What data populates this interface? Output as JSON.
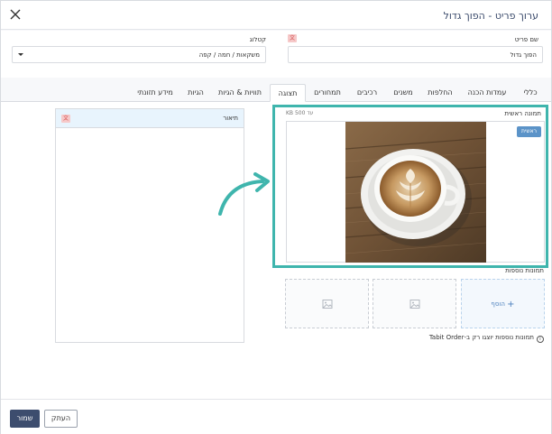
{
  "header": {
    "title": "ערוך פריט  -  הפוך גדול",
    "close_icon": "close-icon"
  },
  "form": {
    "item_name_label": "שם פריט",
    "item_name_value": "הפוך גדול",
    "catalog_label": "קטלוג",
    "catalog_value": "משקאות / חמה / קפה",
    "flag_icon": "translate-flag-icon"
  },
  "tabs": [
    {
      "label": "כללי"
    },
    {
      "label": "עמדות הכנה"
    },
    {
      "label": "החלפות"
    },
    {
      "label": "משנים"
    },
    {
      "label": "רכיבים"
    },
    {
      "label": "תמחורים"
    },
    {
      "label": "תצוגה"
    },
    {
      "label": "תוויות & הגיות"
    },
    {
      "label": "הגיות"
    },
    {
      "label": "מידע תזונתי"
    }
  ],
  "active_tab": "תצוגה",
  "display": {
    "main_image_label": "תמונה ראשית",
    "size_limit": "עד 500 KB",
    "main_badge": "ראשית",
    "more_images_label": "תמונות נוספות",
    "add_label": "הוסף",
    "info_text": "תמונות נוספות יוצגו רק ב-Tabit Order",
    "info_icon": "info-icon",
    "image_placeholder_icon": "image-placeholder-icon",
    "description_label": "תיאור"
  },
  "footer": {
    "save_label": "שמור",
    "copy_label": "העתק"
  },
  "colors": {
    "accent_teal": "#3fb5ad",
    "primary_button": "#3d4d6e",
    "badge_blue": "#5b93c8",
    "header_panel": "#e8f4fd"
  }
}
